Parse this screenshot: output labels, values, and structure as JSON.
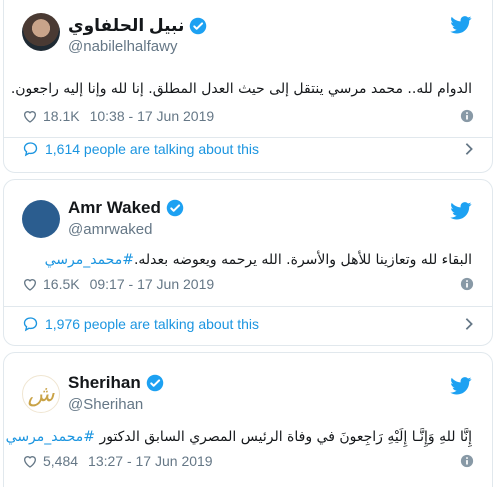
{
  "tweets": [
    {
      "name": "نبيل الحلفاوي",
      "handle": "@nabilelhalfawy",
      "text": "الدوام لله.. محمد مرسي ينتقل إلى حيث العدل المطلق. إنا لله وإنا إليه راجعون.",
      "hashtag": "",
      "likes": "18.1K",
      "timestamp": "10:38 - 17 Jun 2019",
      "talking": "1,614 people are talking about this",
      "avatar_icon": "profile-photo-icon"
    },
    {
      "name": "Amr Waked",
      "handle": "@amrwaked",
      "text": "البقاء لله وتعازينا للأهل والأسرة. الله يرحمه ويعوضه بعدله.",
      "hashtag": "#محمد_مرسي",
      "likes": "16.5K",
      "timestamp": "09:17 - 17 Jun 2019",
      "talking": "1,976 people are talking about this",
      "avatar_icon": "blue-circle-avatar-icon"
    },
    {
      "name": "Sherihan",
      "handle": "@Sherihan",
      "text": "إِنَّا للهِ وَإِنَّـا إِلَيْهِ رَاجِعونَ في وفاة الرئيس المصري السابق الدكتور",
      "hashtag": "#محمد_مرسي",
      "likes": "5,484",
      "timestamp": "13:27 - 17 Jun 2019",
      "talking": "",
      "avatar_icon": "calligraphy-logo-icon"
    }
  ],
  "colors": {
    "twitter_blue": "#1da1f2",
    "link_blue": "#1b95e0",
    "muted_gray": "#657786",
    "border": "#e1e8ed"
  }
}
